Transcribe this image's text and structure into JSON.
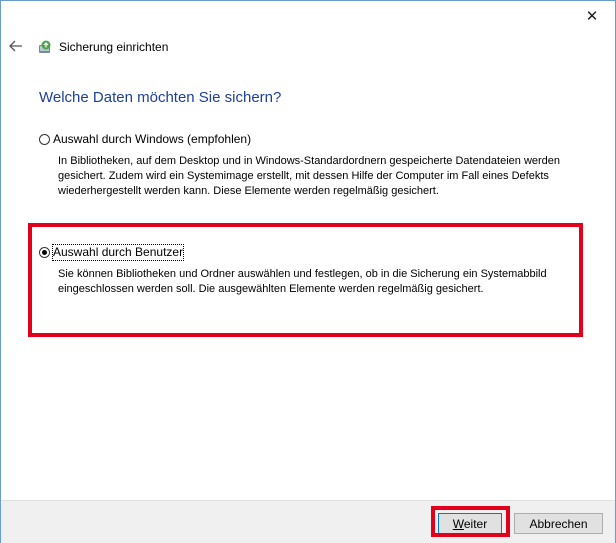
{
  "window": {
    "title": "Sicherung einrichten",
    "close_icon": "close-icon",
    "back_icon": "back-arrow-icon",
    "app_icon": "backup-icon"
  },
  "main": {
    "heading": "Welche Daten möchten Sie sichern?",
    "options": [
      {
        "label": "Auswahl durch Windows (empfohlen)",
        "selected": false,
        "description": "In Bibliotheken, auf dem Desktop und in Windows-Standardordnern gespeicherte Datendateien werden gesichert. Zudem wird ein Systemimage erstellt, mit dessen Hilfe der Computer im Fall eines Defekts wiederhergestellt werden kann. Diese Elemente werden regelmäßig gesichert."
      },
      {
        "label": "Auswahl durch Benutzer",
        "selected": true,
        "description": "Sie können Bibliotheken und Ordner auswählen und festlegen, ob in die Sicherung ein Systemabbild eingeschlossen werden soll. Die ausgewählten Elemente werden regelmäßig gesichert."
      }
    ]
  },
  "footer": {
    "next_label": "Weiter",
    "cancel_label": "Abbrechen"
  },
  "colors": {
    "heading": "#1e3f9a",
    "highlight": "#e3001b",
    "footer_bg": "#f0f0f0",
    "button_bg": "#e1e1e1",
    "default_button_border": "#0078d7"
  }
}
